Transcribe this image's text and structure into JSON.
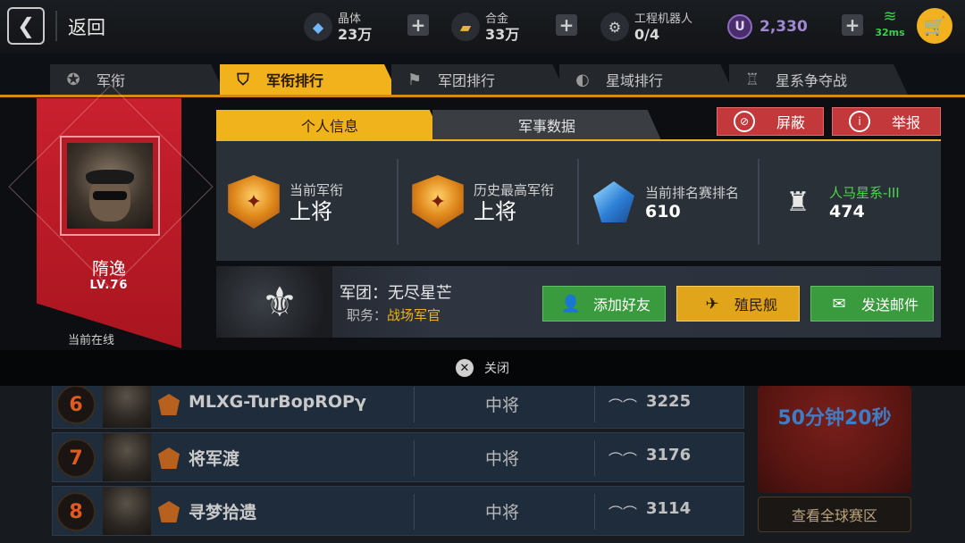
{
  "topbar": {
    "back_label": "返回",
    "resources": [
      {
        "label": "晶体",
        "value": "23万",
        "icon": "crystal-icon"
      },
      {
        "label": "合金",
        "value": "33万",
        "icon": "alloy-icon"
      },
      {
        "label": "工程机器人",
        "value": "0/4",
        "icon": "robot-icon"
      }
    ],
    "u_coin": {
      "symbol": "U",
      "value": "2,330"
    },
    "ping": "32ms"
  },
  "tabs": [
    {
      "label": "军衔",
      "icon": "star-badge-icon",
      "active": false
    },
    {
      "label": "军衔排行",
      "icon": "rank-people-icon",
      "active": true
    },
    {
      "label": "军团排行",
      "icon": "legion-flag-icon",
      "active": false
    },
    {
      "label": "星域排行",
      "icon": "planet-bars-icon",
      "active": false
    },
    {
      "label": "星系争夺战",
      "icon": "trophy-icon",
      "active": false
    }
  ],
  "profile": {
    "name": "隋逸",
    "level": "LV.76",
    "status": "当前在线"
  },
  "card": {
    "tabs": [
      "个人信息",
      "军事数据"
    ],
    "block_label": "屏蔽",
    "report_label": "举报",
    "stats": {
      "current_rank_label": "当前军衔",
      "current_rank_value": "上将",
      "highest_rank_label": "历史最高军衔",
      "highest_rank_value": "上将",
      "ladder_label": "当前排名赛排名",
      "ladder_value": "610",
      "galaxy_label": "人马星系-III",
      "galaxy_value": "474"
    },
    "legion": {
      "name_prefix": "军团：",
      "name": "无尽星芒",
      "duty_prefix": "职务：",
      "duty": "战场军官"
    },
    "buttons": {
      "add_friend": "添加好友",
      "colony_ship": "殖民舰",
      "send_mail": "发送邮件"
    }
  },
  "close_label": "关闭",
  "background_list": [
    {
      "rank": "6",
      "name": "MLXG-TurBopROPγ",
      "title": "中将",
      "score": "3225"
    },
    {
      "rank": "7",
      "name": "将军渡",
      "title": "中将",
      "score": "3176"
    },
    {
      "rank": "8",
      "name": "寻梦拾遗",
      "title": "中将",
      "score": "3114"
    }
  ],
  "side": {
    "countdown": "50分钟20秒",
    "global_button": "查看全球赛区"
  },
  "colors": {
    "accent_gold": "#f1b31b",
    "banner_red": "#c9202e",
    "button_green": "#3a9a3e",
    "report_red": "#c3383b",
    "galaxy_green": "#4bd54b"
  }
}
